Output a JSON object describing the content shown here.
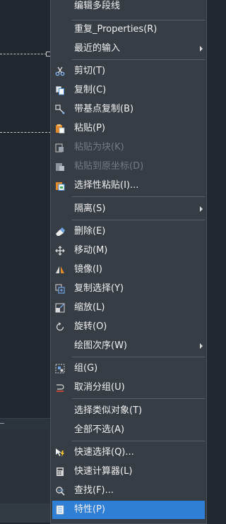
{
  "menu": {
    "items": [
      {
        "id": "edit-polyline",
        "label": "编辑多段线",
        "icon": "",
        "enabled": true,
        "submenu": false
      },
      {
        "id": "repeat-properties",
        "label": "重复_Properties(R)",
        "icon": "",
        "enabled": true,
        "submenu": false
      },
      {
        "id": "recent-input",
        "label": "最近的输入",
        "icon": "",
        "enabled": true,
        "submenu": true
      },
      {
        "id": "cut",
        "label": "剪切(T)",
        "icon": "scissors-icon",
        "enabled": true,
        "submenu": false
      },
      {
        "id": "copy",
        "label": "复制(C)",
        "icon": "copy-icon",
        "enabled": true,
        "submenu": false
      },
      {
        "id": "copy-with-base-point",
        "label": "带基点复制(B)",
        "icon": "copy-base-point-icon",
        "enabled": true,
        "submenu": false
      },
      {
        "id": "paste",
        "label": "粘贴(P)",
        "icon": "paste-icon",
        "enabled": true,
        "submenu": false
      },
      {
        "id": "paste-as-block",
        "label": "粘贴为块(K)",
        "icon": "paste-block-icon",
        "enabled": false,
        "submenu": false
      },
      {
        "id": "paste-to-original-coords",
        "label": "粘贴到原坐标(D)",
        "icon": "paste-original-icon",
        "enabled": false,
        "submenu": false
      },
      {
        "id": "paste-special",
        "label": "选择性粘贴(I)...",
        "icon": "paste-special-icon",
        "enabled": true,
        "submenu": false
      },
      {
        "id": "isolate",
        "label": "隔离(S)",
        "icon": "",
        "enabled": true,
        "submenu": true
      },
      {
        "id": "erase",
        "label": "删除(E)",
        "icon": "eraser-icon",
        "enabled": true,
        "submenu": false
      },
      {
        "id": "move",
        "label": "移动(M)",
        "icon": "move-icon",
        "enabled": true,
        "submenu": false
      },
      {
        "id": "mirror",
        "label": "镜像(I)",
        "icon": "mirror-icon",
        "enabled": true,
        "submenu": false
      },
      {
        "id": "copy-selection",
        "label": "复制选择(Y)",
        "icon": "copy-selection-icon",
        "enabled": true,
        "submenu": false
      },
      {
        "id": "scale",
        "label": "缩放(L)",
        "icon": "scale-icon",
        "enabled": true,
        "submenu": false
      },
      {
        "id": "rotate",
        "label": "旋转(O)",
        "icon": "rotate-icon",
        "enabled": true,
        "submenu": false
      },
      {
        "id": "draw-order",
        "label": "绘图次序(W)",
        "icon": "",
        "enabled": true,
        "submenu": true
      },
      {
        "id": "group",
        "label": "组(G)",
        "icon": "group-icon",
        "enabled": true,
        "submenu": false
      },
      {
        "id": "ungroup",
        "label": "取消分组(U)",
        "icon": "ungroup-icon",
        "enabled": true,
        "submenu": false
      },
      {
        "id": "select-similar",
        "label": "选择类似对象(T)",
        "icon": "",
        "enabled": true,
        "submenu": false
      },
      {
        "id": "deselect-all",
        "label": "全部不选(A)",
        "icon": "",
        "enabled": true,
        "submenu": false
      },
      {
        "id": "quick-select",
        "label": "快速选择(Q)...",
        "icon": "quick-select-icon",
        "enabled": true,
        "submenu": false
      },
      {
        "id": "quickcalc",
        "label": "快速计算器(L)",
        "icon": "calculator-icon",
        "enabled": true,
        "submenu": false
      },
      {
        "id": "find",
        "label": "查找(F)...",
        "icon": "find-icon",
        "enabled": true,
        "submenu": false
      },
      {
        "id": "properties",
        "label": "特性(P)",
        "icon": "properties-icon",
        "enabled": true,
        "submenu": false,
        "selected": true
      }
    ]
  },
  "colors": {
    "menu_bg": "#373d45",
    "highlight": "#2f7fd6",
    "text": "#f0f0f0",
    "disabled_text": "#747b84",
    "canvas_bg": "#212830"
  }
}
